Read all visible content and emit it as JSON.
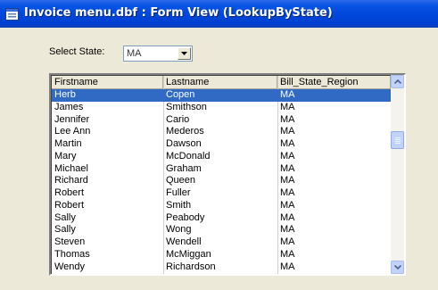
{
  "window": {
    "title": "Invoice menu.dbf : Form View (LookupByState)"
  },
  "filter": {
    "label": "Select State:",
    "value": "MA"
  },
  "grid": {
    "columns": [
      "Firstname",
      "Lastname",
      "Bill_State_Region"
    ],
    "rows": [
      [
        "Herb",
        "Copen",
        "MA"
      ],
      [
        "James",
        "Smithson",
        "MA"
      ],
      [
        "Jennifer",
        "Cario",
        "MA"
      ],
      [
        "Lee Ann",
        "Mederos",
        "MA"
      ],
      [
        "Martin",
        "Dawson",
        "MA"
      ],
      [
        "Mary",
        "McDonald",
        "MA"
      ],
      [
        "Michael",
        "Graham",
        "MA"
      ],
      [
        "Richard",
        "Queen",
        "MA"
      ],
      [
        "Robert",
        "Fuller",
        "MA"
      ],
      [
        "Robert",
        "Smith",
        "MA"
      ],
      [
        "Sally",
        "Peabody",
        "MA"
      ],
      [
        "Sally",
        "Wong",
        "MA"
      ],
      [
        "Steven",
        "Wendell",
        "MA"
      ],
      [
        "Thomas",
        "McMiggan",
        "MA"
      ],
      [
        "Wendy",
        "Richardson",
        "MA"
      ]
    ],
    "selected_row": 0
  },
  "icons": {
    "app": "form-window-icon",
    "dropdown": "chevron-down-icon",
    "scroll_up": "arrow-up-icon",
    "scroll_down": "arrow-down-icon"
  },
  "colors": {
    "titlebar": "#0048dc",
    "selection": "#316ac5",
    "face": "#ece9d8"
  }
}
